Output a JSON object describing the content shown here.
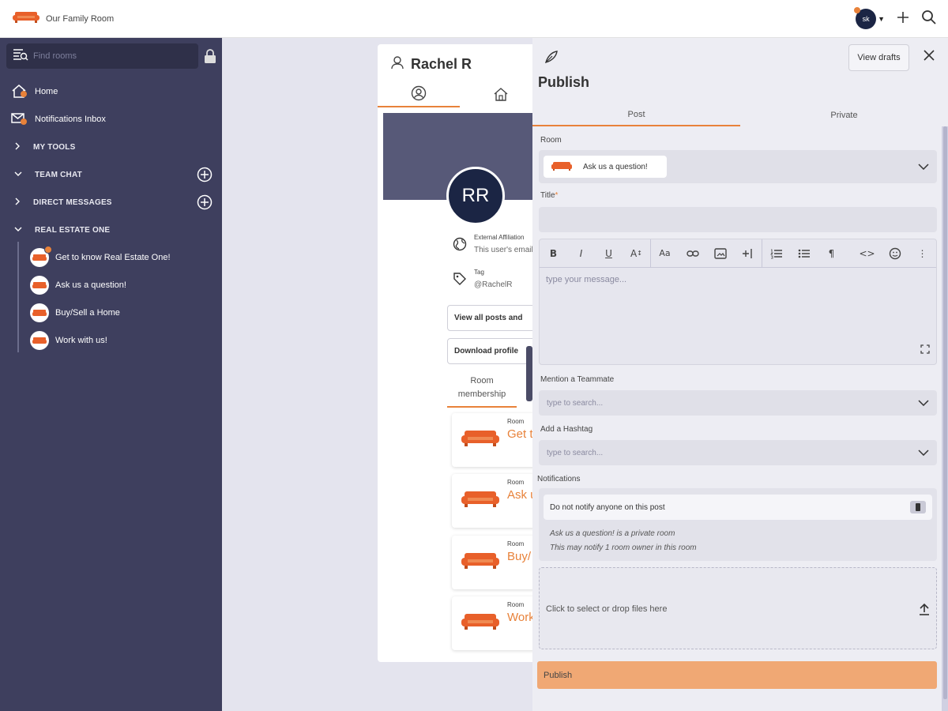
{
  "app": {
    "name": "Our Family Room",
    "avatar_initials": "sk",
    "accent": "#e8823a",
    "sidebar_bg": "#3e3f5e"
  },
  "sidebar": {
    "search_placeholder": "Find rooms",
    "home": "Home",
    "notifications": "Notifications Inbox",
    "sections": [
      {
        "label": "MY TOOLS"
      },
      {
        "label": "TEAM CHAT"
      },
      {
        "label": "DIRECT MESSAGES"
      },
      {
        "label": "REAL ESTATE ONE"
      }
    ],
    "rooms": [
      {
        "label": "Get to know Real Estate One!"
      },
      {
        "label": "Ask us a question!"
      },
      {
        "label": "Buy/Sell a Home"
      },
      {
        "label": "Work with us!"
      }
    ]
  },
  "profile": {
    "name": "Rachel R",
    "initials": "RR",
    "affiliation_label": "External Affiliation",
    "affiliation_value": "This user's email",
    "tag_label": "Tag",
    "tag_value": "@RachelR",
    "view_posts": "View all posts and",
    "download_profile": "Download profile",
    "room_membership": "Room membership",
    "room_card_label": "Room",
    "room_cards": [
      {
        "name": "Get t"
      },
      {
        "name": "Ask u"
      },
      {
        "name": "Buy/"
      },
      {
        "name": "Work"
      }
    ]
  },
  "publish": {
    "title": "Publish",
    "view_drafts": "View drafts",
    "tabs": [
      {
        "label": "Post"
      },
      {
        "label": "Private"
      }
    ],
    "room_label": "Room",
    "room_selected": "Ask us a question!",
    "title_label": "Title",
    "title_required": "*",
    "title_value": "",
    "editor_placeholder": "type your message...",
    "mention_label": "Mention a Teammate",
    "mention_placeholder": "type to search...",
    "hashtag_label": "Add a Hashtag",
    "hashtag_placeholder": "type to search...",
    "notifications_label": "Notifications",
    "notify_option": "Do not notify anyone on this post",
    "notify_note_1": "Ask us a question! is a private room",
    "notify_note_2": "This may notify 1 room owner in this room",
    "dropzone_text": "Click to select or drop files here",
    "publish_button": "Publish"
  }
}
